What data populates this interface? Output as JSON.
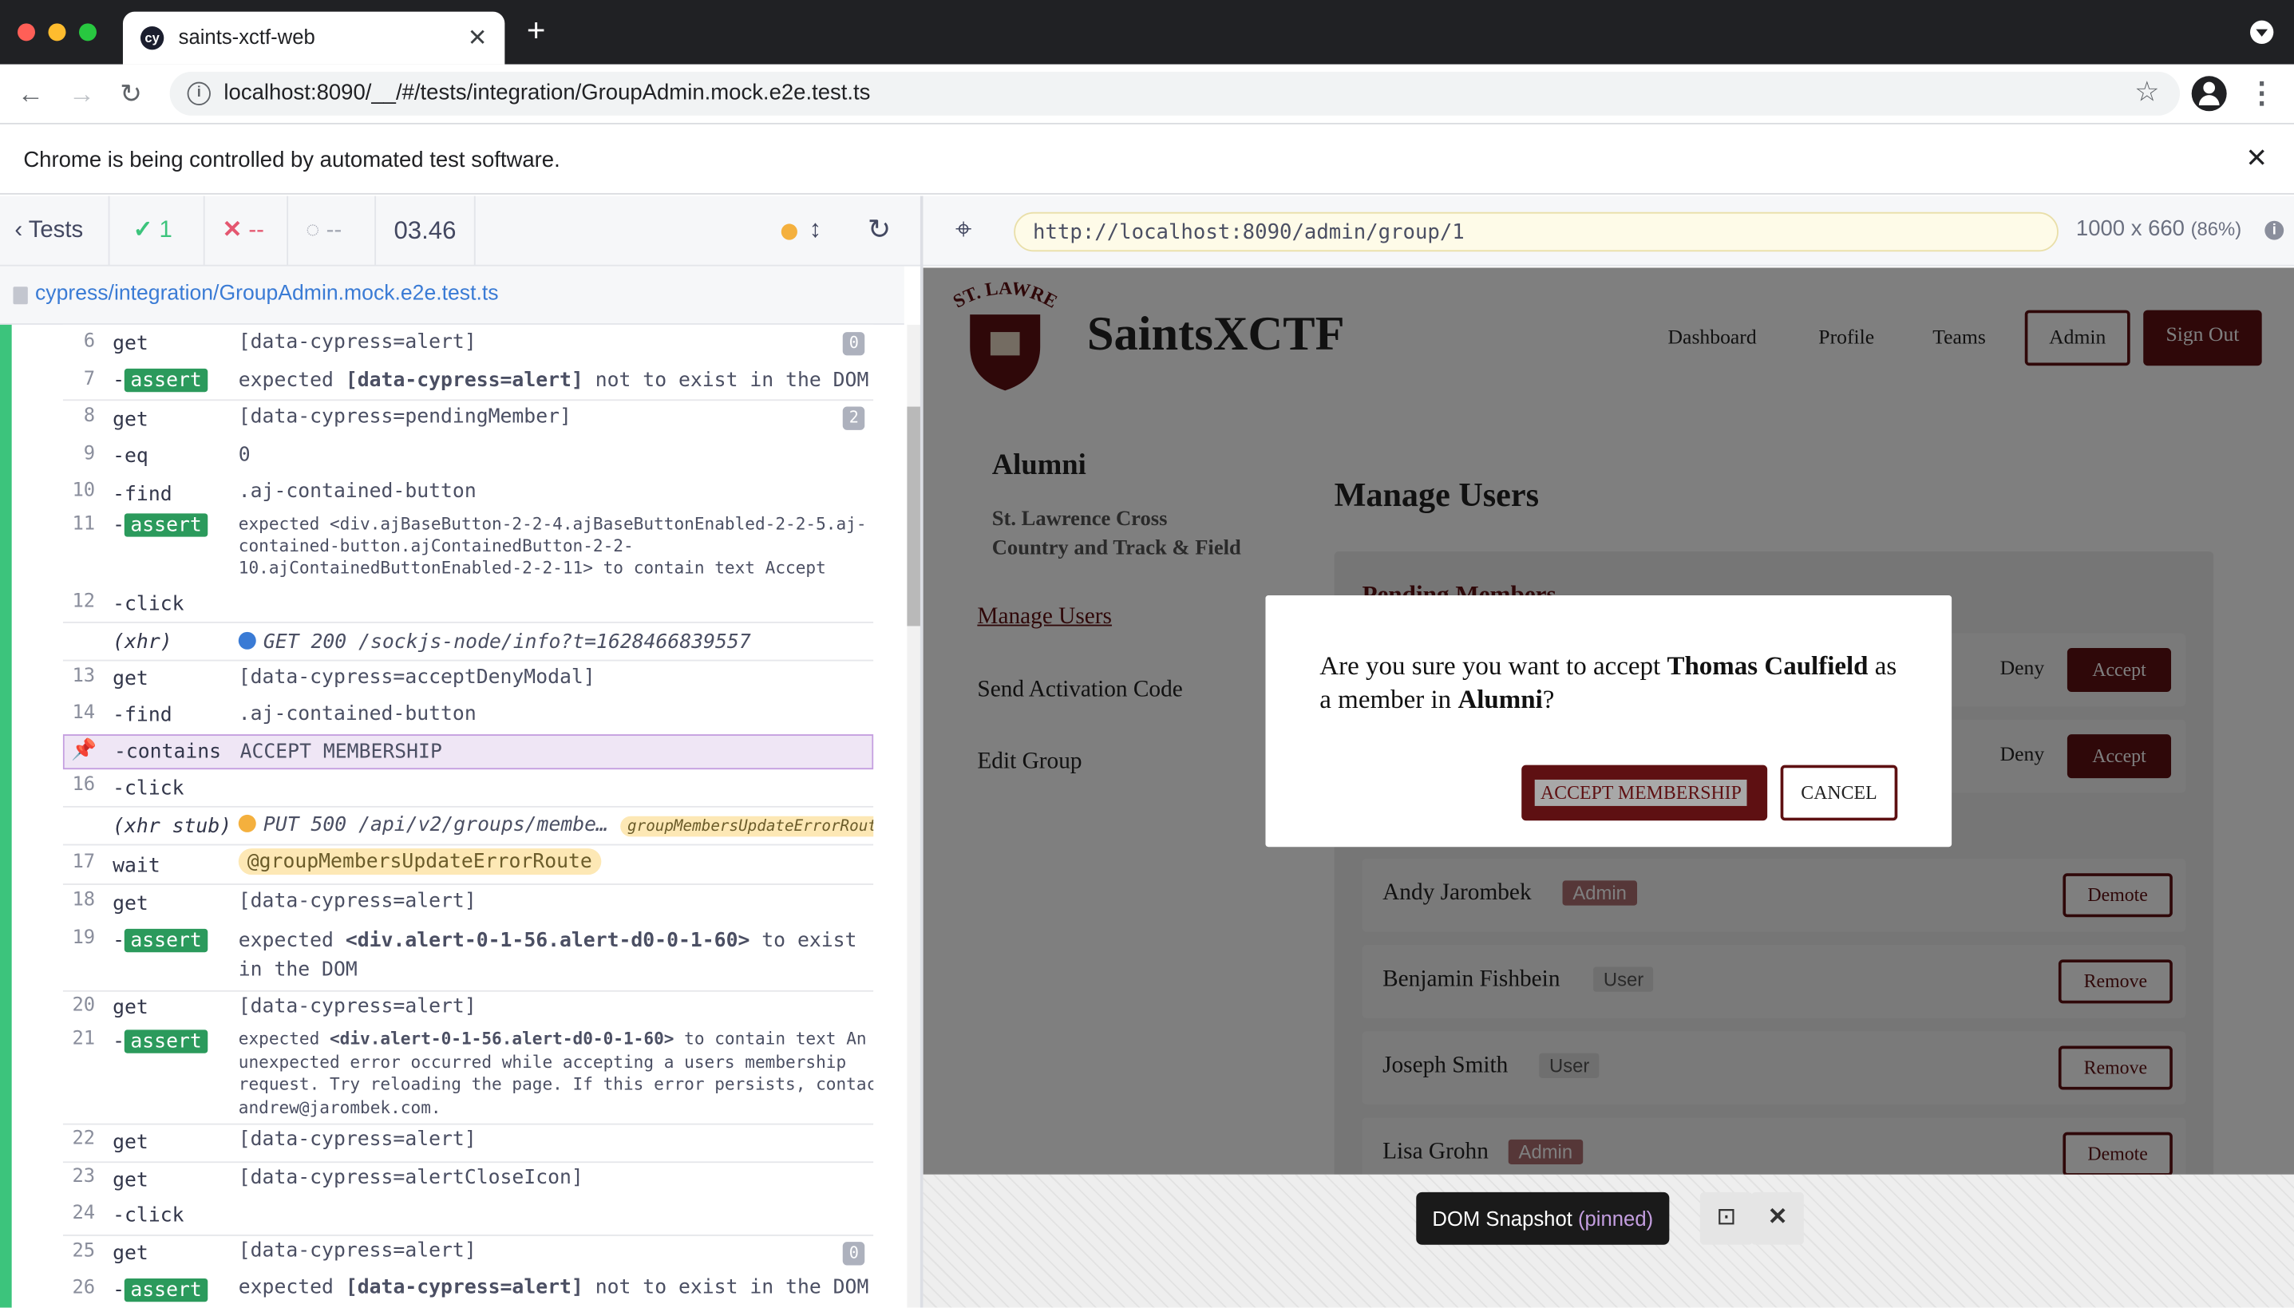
{
  "browser": {
    "tab_title": "saints-xctf-web",
    "url": "localhost:8090/__/#/tests/integration/GroupAdmin.mock.e2e.test.ts",
    "infobar": "Chrome is being controlled by automated test software."
  },
  "cypress": {
    "tests_label": "Tests",
    "passed": "1",
    "failed": "--",
    "pending": "--",
    "duration": "03.46",
    "spec_path": "cypress/integration/GroupAdmin.mock.e2e.test.ts",
    "aut_url": "http://localhost:8090/admin/group/1",
    "viewport": "1000 x 660",
    "viewport_pct": "(86%)",
    "snapshot_label": "DOM Snapshot",
    "snapshot_pinned": "(pinned)"
  },
  "log": [
    {
      "num": "6",
      "cmd": "get",
      "msg": "[data-cypress=alert]",
      "badge": "0"
    },
    {
      "num": "7",
      "cmd": "-assert",
      "msg_pre": "expected ",
      "msg_code": "[data-cypress=alert]",
      "msg_post": " not to exist in the DOM"
    },
    {
      "num": "8",
      "cmd": "get",
      "msg": "[data-cypress=pendingMember]",
      "badge": "2"
    },
    {
      "num": "9",
      "cmd": "-eq",
      "msg": "0"
    },
    {
      "num": "10",
      "cmd": "-find",
      "msg": ".aj-contained-button"
    },
    {
      "num": "11",
      "cmd": "-assert",
      "l1": "expected <div.ajBaseButton-2-2-4.ajBaseButtonEnabled-2-2-5.aj-",
      "l2": "contained-button.ajContainedButton-2-2-",
      "l3a": "10.ajContainedButtonEnabled-2-2-11>",
      "l3b": " to contain text ",
      "l3c": "Accept"
    },
    {
      "num": "12",
      "cmd": "-click",
      "msg": ""
    },
    {
      "num": "",
      "cmd": "(xhr)",
      "msg": "GET 200 /sockjs-node/info?t=1628466839557"
    },
    {
      "num": "13",
      "cmd": "get",
      "msg": "[data-cypress=acceptDenyModal]"
    },
    {
      "num": "14",
      "cmd": "-find",
      "msg": ".aj-contained-button"
    },
    {
      "num": "",
      "cmd": "-contains",
      "msg": "ACCEPT MEMBERSHIP"
    },
    {
      "num": "16",
      "cmd": "-click",
      "msg": ""
    },
    {
      "num": "",
      "cmd": "(xhr stub)",
      "msg": "PUT 500 /api/v2/groups/membe…",
      "alias": "groupMembersUpdateErrorRoute"
    },
    {
      "num": "17",
      "cmd": "wait",
      "msg": "@groupMembersUpdateErrorRoute"
    },
    {
      "num": "18",
      "cmd": "get",
      "msg": "[data-cypress=alert]"
    },
    {
      "num": "19",
      "cmd": "-assert",
      "l1a": "expected ",
      "l1b": "<div.alert-0-1-56.alert-d0-0-1-60>",
      "l1c": " to exist",
      "l2": "in the DOM"
    },
    {
      "num": "20",
      "cmd": "get",
      "msg": "[data-cypress=alert]"
    },
    {
      "num": "21",
      "cmd": "-assert",
      "l1a": "expected ",
      "l1b": "<div.alert-0-1-56.alert-d0-0-1-60>",
      "l1c": " to contain text ",
      "l1d": "An",
      "l2": "unexpected error occurred while accepting a users membership",
      "l3": "request. Try reloading the page. If this error persists, contact",
      "l4": "andrew@jarombek.com."
    },
    {
      "num": "22",
      "cmd": "get",
      "msg": "[data-cypress=alert]"
    },
    {
      "num": "23",
      "cmd": "get",
      "msg": "[data-cypress=alertCloseIcon]"
    },
    {
      "num": "24",
      "cmd": "-click",
      "msg": ""
    },
    {
      "num": "25",
      "cmd": "get",
      "msg": "[data-cypress=alert]",
      "badge": "0"
    },
    {
      "num": "26",
      "cmd": "-assert",
      "msg_pre": "expected ",
      "msg_code": "[data-cypress=alert]",
      "msg_post": " not to exist in the DOM"
    }
  ],
  "app": {
    "logo_text": "ST. LAWRENCE",
    "brand": "SaintsXCTF",
    "nav": [
      "Dashboard",
      "Profile",
      "Teams",
      "Admin",
      "Sign Out"
    ],
    "group_name": "Alumni",
    "group_desc_1": "St. Lawrence Cross",
    "group_desc_2": "Country and Track & Field",
    "side_links": [
      "Manage Users",
      "Send Activation Code",
      "Edit Group"
    ],
    "heading": "Manage Users",
    "pending_title": "Pending Members",
    "pending_rows": [
      {
        "deny": "Deny",
        "accept": "Accept"
      },
      {
        "deny": "Deny",
        "accept": "Accept"
      }
    ],
    "members": [
      {
        "name": "Andy Jarombek",
        "role": "Admin",
        "action": "Demote"
      },
      {
        "name": "Benjamin Fishbein",
        "role": "User",
        "action": "Remove"
      },
      {
        "name": "Joseph Smith",
        "role": "User",
        "action": "Remove"
      },
      {
        "name": "Lisa Grohn",
        "role": "Admin",
        "action": "Demote"
      }
    ],
    "modal": {
      "q1": "Are you sure you want to accept ",
      "name": "Thomas Caulfield",
      "q2": " as a member in ",
      "group": "Alumni",
      "q3": "?",
      "accept": "ACCEPT MEMBERSHIP",
      "cancel": "CANCEL"
    }
  },
  "colors": {
    "brand": "#5e1012",
    "pass": "#3cc47c",
    "assert": "#2b9a5c"
  }
}
